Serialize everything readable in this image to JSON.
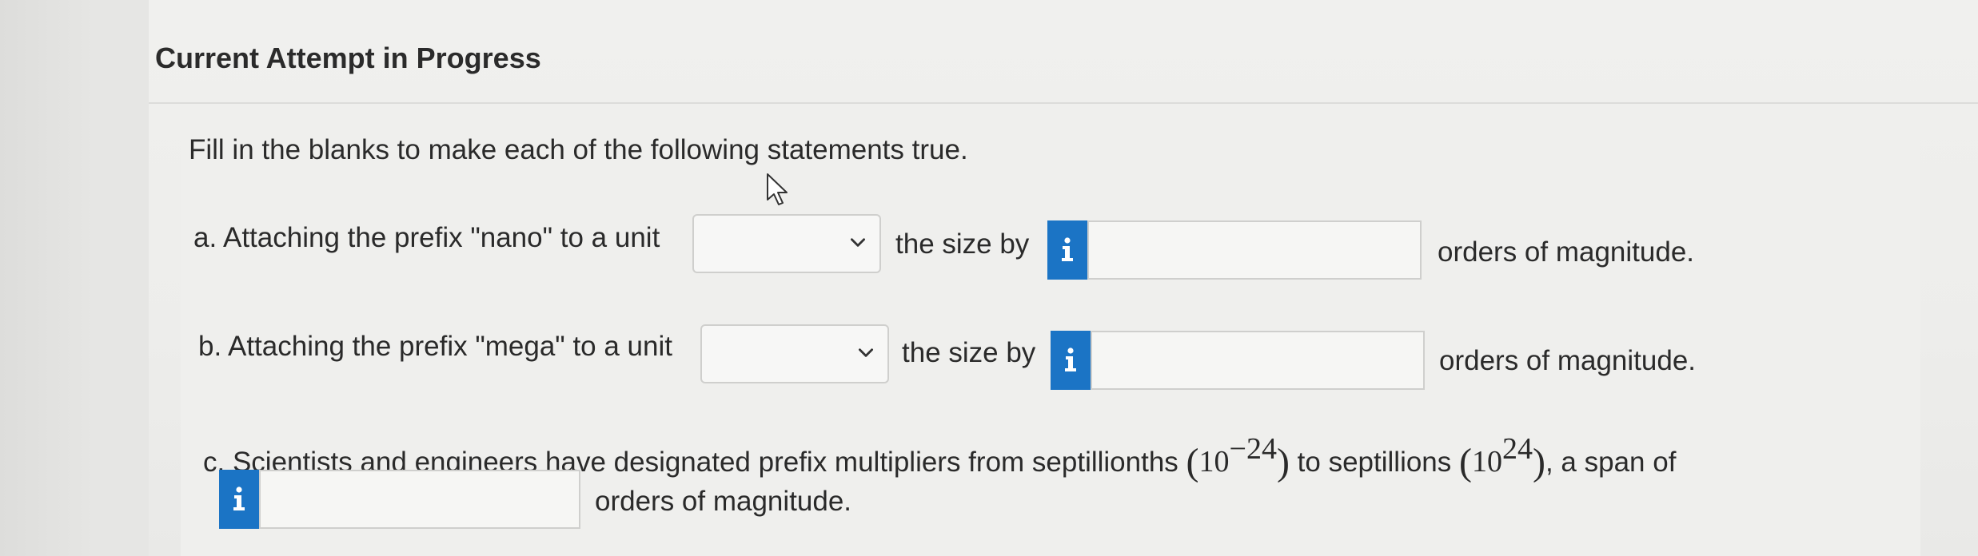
{
  "header": {
    "title": "Current Attempt in Progress"
  },
  "instructions": "Fill in the blanks to make each of the following statements true.",
  "questions": {
    "a": {
      "label": "a. Attaching the prefix \"nano\" to a unit",
      "dropdown_value": "",
      "middle_text": "the size by",
      "answer_value": "",
      "suffix": "orders of magnitude."
    },
    "b": {
      "label": "b. Attaching the prefix \"mega\" to a unit",
      "dropdown_value": "",
      "middle_text": "the size by",
      "answer_value": "",
      "suffix": "orders of magnitude."
    },
    "c": {
      "text1": "c. Scientists and engineers have designated prefix multipliers from septillionths",
      "exp_base": "10",
      "exp_low": "−24",
      "text2": "to septillions",
      "exp_high": "24",
      "text3": ", a span of",
      "answer_value": "",
      "suffix": "orders of magnitude."
    }
  },
  "icons": {
    "info": "info-icon",
    "dropdown": "chevron-down-icon",
    "cursor": "mouse-cursor-icon"
  },
  "colors": {
    "info_button": "#1b74c5",
    "text": "#2a2a2a"
  }
}
